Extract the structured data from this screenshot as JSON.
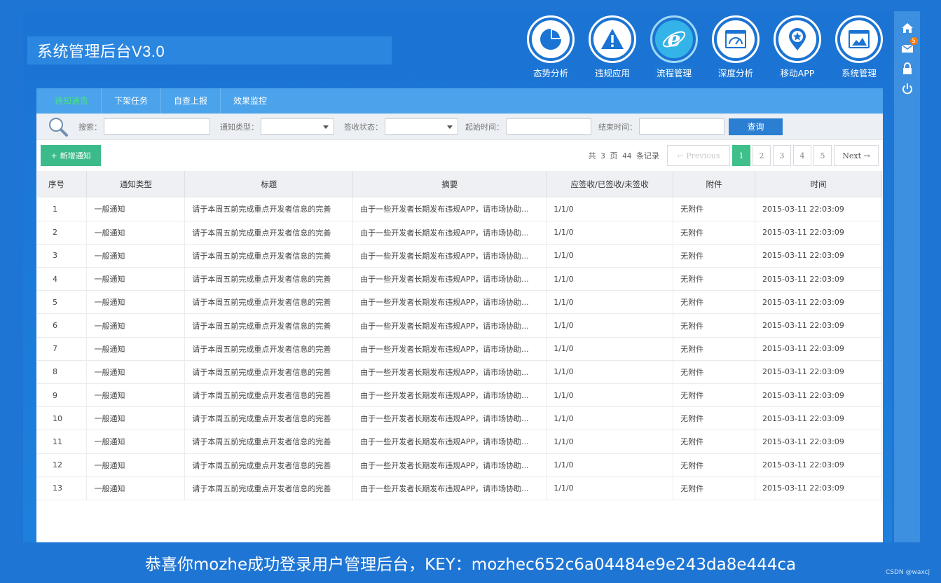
{
  "app": {
    "title": "系统管理后台V3.0"
  },
  "nav": [
    {
      "label": "态势分析",
      "icon": "pie-chart-icon"
    },
    {
      "label": "违规应用",
      "icon": "warning-icon"
    },
    {
      "label": "流程管理",
      "icon": "ie-browser-icon"
    },
    {
      "label": "深度分析",
      "icon": "dashboard-gauge-icon"
    },
    {
      "label": "移动APP",
      "icon": "location-star-icon"
    },
    {
      "label": "系统管理",
      "icon": "window-settings-icon"
    }
  ],
  "side": {
    "mail_count": "5"
  },
  "tabs": [
    "通知通告",
    "下架任务",
    "自查上报",
    "效果监控"
  ],
  "search": {
    "search_label": "搜索：",
    "type_label": "通知类型：",
    "status_label": "签收状态：",
    "start_label": "起始时间：",
    "end_label": "结束时间：",
    "query_button": "查询"
  },
  "toolbar": {
    "add_button": "新增通知",
    "pager_info": "共 3 页 44 条记录",
    "prev": "← Previous",
    "pages": [
      "1",
      "2",
      "3",
      "4",
      "5"
    ],
    "current_page": "1",
    "next": "Next →"
  },
  "table": {
    "headers": [
      "序号",
      "通知类型",
      "标题",
      "摘要",
      "应签收/已签收/未签收",
      "附件",
      "时间"
    ],
    "rows": [
      [
        "1",
        "一般通知",
        "请于本周五前完成重点开发者信息的完善",
        "由于一些开发者长期发布违规APP，请市场协助...",
        "1/1/0",
        "无附件",
        "2015-03-11 22:03:09"
      ],
      [
        "2",
        "一般通知",
        "请于本周五前完成重点开发者信息的完善",
        "由于一些开发者长期发布违规APP，请市场协助...",
        "1/1/0",
        "无附件",
        "2015-03-11 22:03:09"
      ],
      [
        "3",
        "一般通知",
        "请于本周五前完成重点开发者信息的完善",
        "由于一些开发者长期发布违规APP，请市场协助...",
        "1/1/0",
        "无附件",
        "2015-03-11 22:03:09"
      ],
      [
        "4",
        "一般通知",
        "请于本周五前完成重点开发者信息的完善",
        "由于一些开发者长期发布违规APP，请市场协助...",
        "1/1/0",
        "无附件",
        "2015-03-11 22:03:09"
      ],
      [
        "5",
        "一般通知",
        "请于本周五前完成重点开发者信息的完善",
        "由于一些开发者长期发布违规APP，请市场协助...",
        "1/1/0",
        "无附件",
        "2015-03-11 22:03:09"
      ],
      [
        "6",
        "一般通知",
        "请于本周五前完成重点开发者信息的完善",
        "由于一些开发者长期发布违规APP，请市场协助...",
        "1/1/0",
        "无附件",
        "2015-03-11 22:03:09"
      ],
      [
        "7",
        "一般通知",
        "请于本周五前完成重点开发者信息的完善",
        "由于一些开发者长期发布违规APP，请市场协助...",
        "1/1/0",
        "无附件",
        "2015-03-11 22:03:09"
      ],
      [
        "8",
        "一般通知",
        "请于本周五前完成重点开发者信息的完善",
        "由于一些开发者长期发布违规APP，请市场协助...",
        "1/1/0",
        "无附件",
        "2015-03-11 22:03:09"
      ],
      [
        "9",
        "一般通知",
        "请于本周五前完成重点开发者信息的完善",
        "由于一些开发者长期发布违规APP，请市场协助...",
        "1/1/0",
        "无附件",
        "2015-03-11 22:03:09"
      ],
      [
        "10",
        "一般通知",
        "请于本周五前完成重点开发者信息的完善",
        "由于一些开发者长期发布违规APP，请市场协助...",
        "1/1/0",
        "无附件",
        "2015-03-11 22:03:09"
      ],
      [
        "11",
        "一般通知",
        "请于本周五前完成重点开发者信息的完善",
        "由于一些开发者长期发布违规APP，请市场协助...",
        "1/1/0",
        "无附件",
        "2015-03-11 22:03:09"
      ],
      [
        "12",
        "一般通知",
        "请于本周五前完成重点开发者信息的完善",
        "由于一些开发者长期发布违规APP，请市场协助...",
        "1/1/0",
        "无附件",
        "2015-03-11 22:03:09"
      ],
      [
        "13",
        "一般通知",
        "请于本周五前完成重点开发者信息的完善",
        "由于一些开发者长期发布违规APP，请市场协助...",
        "1/1/0",
        "无附件",
        "2015-03-11 22:03:09"
      ]
    ]
  },
  "ticker": "恭喜你mozhe成功登录用户管理后台，KEY：mozhec652c6a04484e9e243da8e444ca",
  "watermark": "CSDN @waxcj"
}
